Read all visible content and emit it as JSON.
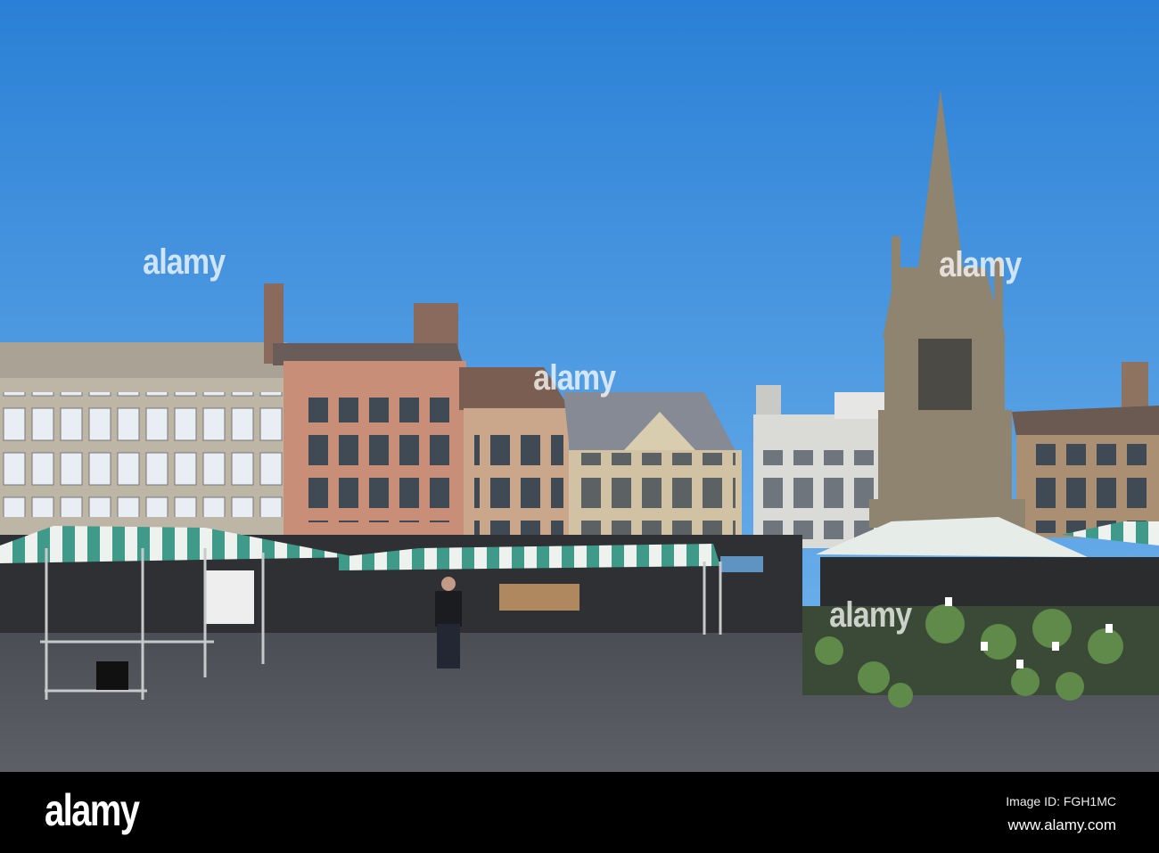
{
  "watermark": {
    "text": "alamy"
  },
  "footer": {
    "logo": "alamy",
    "image_id": "Image ID: FGH1MC",
    "website": "www.alamy.com"
  }
}
